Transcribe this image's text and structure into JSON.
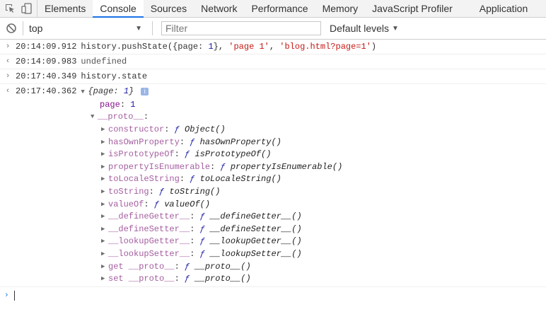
{
  "tabs": [
    "Elements",
    "Console",
    "Sources",
    "Network",
    "Performance",
    "Memory",
    "JavaScript Profiler",
    "Application"
  ],
  "active_tab": "Console",
  "toolbar": {
    "context": "top",
    "filter_placeholder": "Filter",
    "levels": "Default levels"
  },
  "entries": [
    {
      "kind": "input",
      "time": "20:14:09.912",
      "code": {
        "pre": "history.pushState({page: ",
        "num": "1",
        "mid": "}, ",
        "s1": "'page 1'",
        "c": ", ",
        "s2": "'blog.html?page=1'",
        "end": ")"
      }
    },
    {
      "kind": "output",
      "time": "20:14:09.983",
      "text": "undefined"
    },
    {
      "kind": "input",
      "time": "20:17:40.349",
      "text": "history.state"
    }
  ],
  "object_entry": {
    "time": "20:17:40.362",
    "preview": {
      "open": "{page: ",
      "val": "1",
      "close": "}"
    },
    "info_glyph": "i",
    "page_key": "page",
    "page_value": "1",
    "proto_label": "__proto__",
    "members": [
      {
        "key": "constructor",
        "name": "Object()"
      },
      {
        "key": "hasOwnProperty",
        "name": "hasOwnProperty()"
      },
      {
        "key": "isPrototypeOf",
        "name": "isPrototypeOf()"
      },
      {
        "key": "propertyIsEnumerable",
        "name": "propertyIsEnumerable()"
      },
      {
        "key": "toLocaleString",
        "name": "toLocaleString()"
      },
      {
        "key": "toString",
        "name": "toString()"
      },
      {
        "key": "valueOf",
        "name": "valueOf()"
      },
      {
        "key": "__defineGetter__",
        "name": "__defineGetter__()"
      },
      {
        "key": "__defineSetter__",
        "name": "__defineSetter__()"
      },
      {
        "key": "__lookupGetter__",
        "name": "__lookupGetter__()"
      },
      {
        "key": "__lookupSetter__",
        "name": "__lookupSetter__()"
      },
      {
        "key": "get __proto__",
        "name": "__proto__()"
      },
      {
        "key": "set __proto__",
        "name": "__proto__()"
      }
    ],
    "fn_glyph": "ƒ"
  },
  "glyphs": {
    "in": "›",
    "out": "‹",
    "tri_right": "▶",
    "tri_down": "▼",
    "prompt": "›",
    "dropdown": "▼"
  }
}
